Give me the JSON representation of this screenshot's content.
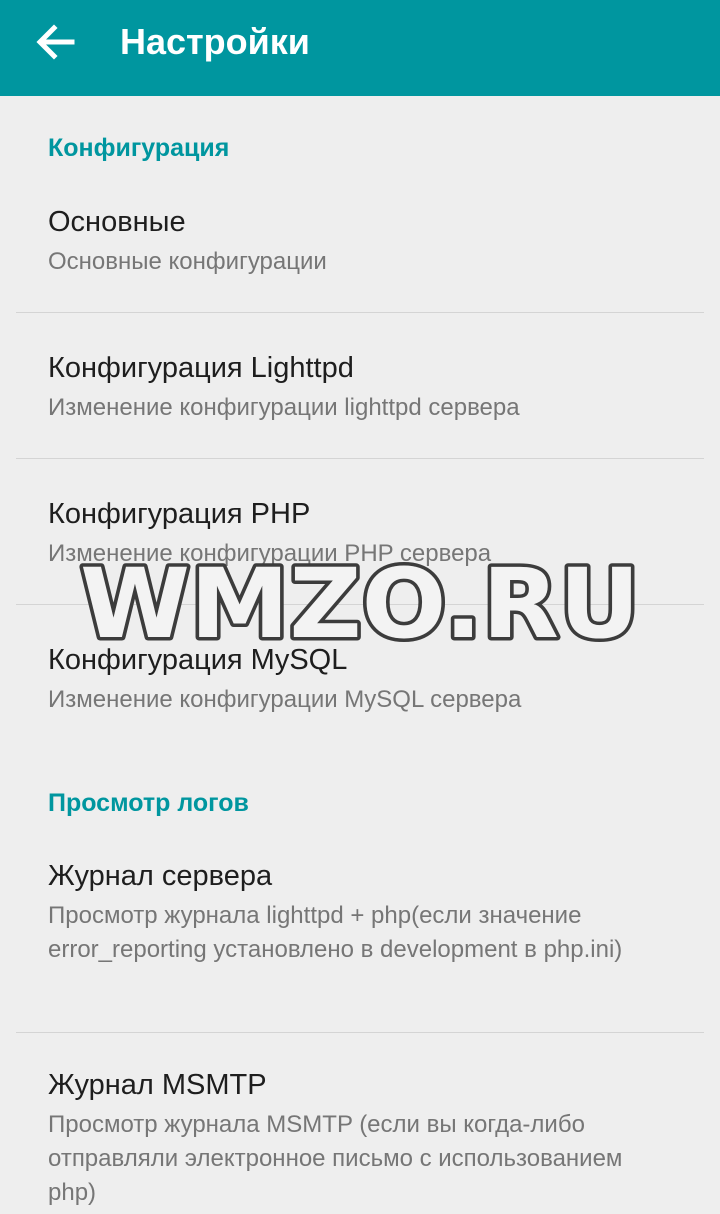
{
  "app_bar": {
    "title": "Настройки",
    "back_icon": "arrow-left-icon",
    "background": "#00969f"
  },
  "sections": [
    {
      "header": "Конфигурация",
      "items": [
        {
          "title": "Основные",
          "summary": "Основные конфигурации"
        },
        {
          "title": "Конфигурация Lighttpd",
          "summary": "Изменение конфигурации lighttpd сервера"
        },
        {
          "title": "Конфигурация PHP",
          "summary": "Изменение конфигурации PHP сервера"
        },
        {
          "title": "Конфигурация MySQL",
          "summary": "Изменение конфигурации MySQL сервера"
        }
      ]
    },
    {
      "header": "Просмотр логов",
      "items": [
        {
          "title": "Журнал сервера",
          "summary": "Просмотр журнала lighttpd + php(если значение error_reporting установлено в development в php.ini)"
        },
        {
          "title": "Журнал MSMTP",
          "summary": "Просмотр журнала MSMTP (если вы когда-либо отправляли электронное письмо с использованием php)"
        }
      ]
    }
  ],
  "watermark": {
    "text": "WMZO.RU"
  },
  "colors": {
    "accent": "#00969f",
    "background": "#eeeeee",
    "title_text": "#1e1e1e",
    "summary_text": "#767676"
  }
}
